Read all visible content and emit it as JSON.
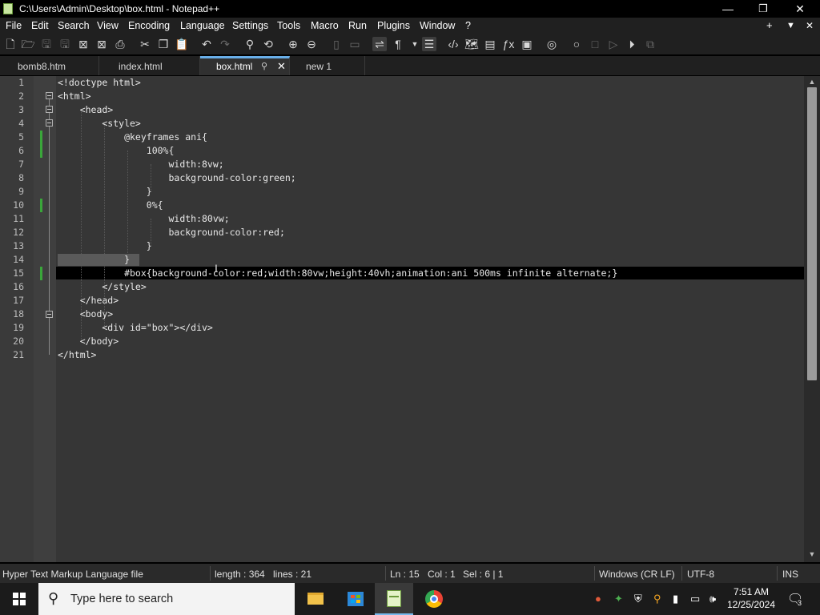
{
  "window": {
    "title": "C:\\Users\\Admin\\Desktop\\box.html - Notepad++",
    "minimize": "—",
    "restore": "❐",
    "close": "✕"
  },
  "menu": {
    "items": [
      "File",
      "Edit",
      "Search",
      "View",
      "Encoding",
      "Language",
      "Settings",
      "Tools",
      "Macro",
      "Run",
      "Plugins",
      "Window",
      "?"
    ],
    "right": [
      "+",
      "▼",
      "✕"
    ]
  },
  "tabs": [
    {
      "label": "bomb8.htm"
    },
    {
      "label": "index.html"
    },
    {
      "label": "box.html",
      "active": true,
      "pin": "⚲",
      "close": "✕"
    },
    {
      "label": "new 1"
    }
  ],
  "editor": {
    "lines": [
      "<!doctype html>",
      "<html>",
      "    <head>",
      "        <style>",
      "            @keyframes ani{",
      "                100%{",
      "                    width:8vw;",
      "                    background-color:green;",
      "                }",
      "                0%{",
      "                    width:80vw;",
      "                    background-color:red;",
      "                }",
      "            }",
      "            #box{background-color:red;width:80vw;height:40vh;animation:ani 500ms infinite alternate;}",
      "        </style>",
      "    </head>",
      "    <body>",
      "        <div id=\"box\"></div>",
      "    </body>",
      "</html>"
    ],
    "numbers": [
      "1",
      "2",
      "3",
      "4",
      "5",
      "6",
      "7",
      "8",
      "9",
      "10",
      "11",
      "12",
      "13",
      "14",
      "15",
      "16",
      "17",
      "18",
      "19",
      "20",
      "21"
    ]
  },
  "status": {
    "filetype": "Hyper Text Markup Language file",
    "length": "length : 364",
    "lines": "lines : 21",
    "ln": "Ln : 15",
    "col": "Col : 1",
    "sel": "Sel : 6 | 1",
    "eol": "Windows (CR LF)",
    "encoding": "UTF-8",
    "mode": "INS"
  },
  "taskbar": {
    "search_placeholder": "Type here to search",
    "time": "7:51 AM",
    "date": "12/25/2024",
    "notification_count": "3"
  },
  "colors": {
    "accent": "#68aee8",
    "change_marker": "#3aa63a",
    "editor_bg": "#363636"
  }
}
